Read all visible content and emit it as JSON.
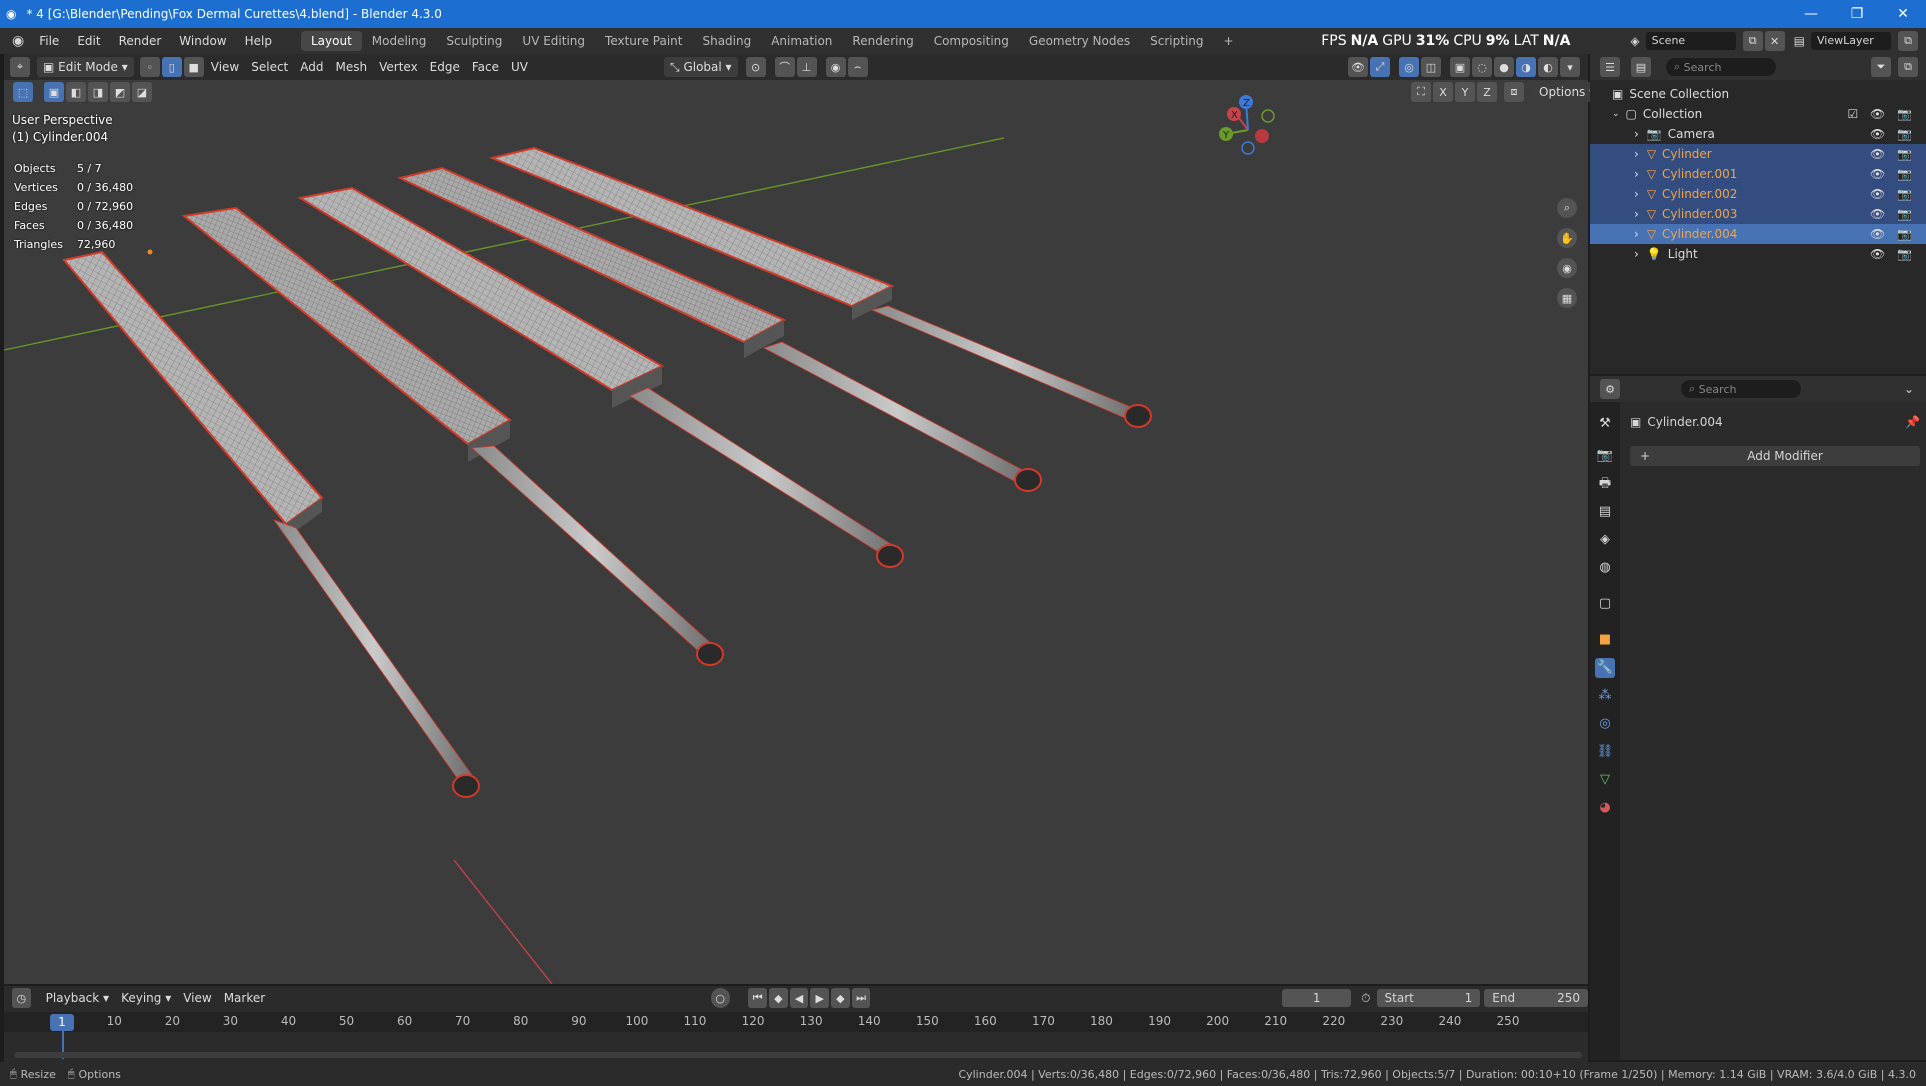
{
  "window": {
    "title": "* 4 [G:\\Blender\\Pending\\Fox Dermal Curettes\\4.blend] - Blender 4.3.0"
  },
  "menus": [
    "File",
    "Edit",
    "Render",
    "Window",
    "Help"
  ],
  "workspaces": [
    "Layout",
    "Modeling",
    "Sculpting",
    "UV Editing",
    "Texture Paint",
    "Shading",
    "Animation",
    "Rendering",
    "Compositing",
    "Geometry Nodes",
    "Scripting"
  ],
  "stats_bar": {
    "fps_label": "FPS",
    "fps": "N/A",
    "gpu_label": "GPU",
    "gpu": "31%",
    "cpu_label": "CPU",
    "cpu": "9%",
    "lat_label": "LAT",
    "lat": "N/A"
  },
  "scene": {
    "name": "Scene",
    "viewlayer": "ViewLayer"
  },
  "viewport_header": {
    "mode": "Edit Mode",
    "menus": [
      "View",
      "Select",
      "Add",
      "Mesh",
      "Vertex",
      "Edge",
      "Face",
      "UV"
    ],
    "orientation": "Global",
    "options": "Options",
    "axes": [
      "X",
      "Y",
      "Z"
    ]
  },
  "viewport": {
    "view_name": "User Perspective",
    "active_object": "(1) Cylinder.004",
    "stats": [
      {
        "label": "Objects",
        "value": "5 / 7"
      },
      {
        "label": "Vertices",
        "value": "0 / 36,480"
      },
      {
        "label": "Edges",
        "value": "0 / 72,960"
      },
      {
        "label": "Faces",
        "value": "0 / 36,480"
      },
      {
        "label": "Triangles",
        "value": "72,960"
      }
    ]
  },
  "outliner": {
    "search_placeholder": "Search",
    "scene_collection": "Scene Collection",
    "collection": "Collection",
    "items": [
      {
        "name": "Camera",
        "state": "normal",
        "icon": "camera-icon"
      },
      {
        "name": "Cylinder",
        "state": "selected",
        "icon": "mesh-icon"
      },
      {
        "name": "Cylinder.001",
        "state": "selected",
        "icon": "mesh-icon"
      },
      {
        "name": "Cylinder.002",
        "state": "selected",
        "icon": "mesh-icon"
      },
      {
        "name": "Cylinder.003",
        "state": "selected",
        "icon": "mesh-icon"
      },
      {
        "name": "Cylinder.004",
        "state": "active",
        "icon": "mesh-icon"
      },
      {
        "name": "Light",
        "state": "normal",
        "icon": "light-icon"
      }
    ]
  },
  "properties": {
    "search_placeholder": "Search",
    "object_name": "Cylinder.004",
    "add_modifier": "Add Modifier"
  },
  "timeline": {
    "menus": [
      "Playback",
      "Keying",
      "View",
      "Marker"
    ],
    "current_frame": "1",
    "start_label": "Start",
    "start": "1",
    "end_label": "End",
    "end": "250",
    "ticks": [
      "10",
      "20",
      "30",
      "40",
      "50",
      "60",
      "70",
      "80",
      "90",
      "100",
      "110",
      "120",
      "130",
      "140",
      "150",
      "160",
      "170",
      "180",
      "190",
      "200",
      "210",
      "220",
      "230",
      "240",
      "250"
    ],
    "frame_indicator": "1"
  },
  "status_bar": {
    "left": [
      "Resize",
      "Options"
    ],
    "right": "Cylinder.004 | Verts:0/36,480 | Edges:0/72,960 | Faces:0/36,480 | Tris:72,960 | Objects:5/7 | Duration: 00:10+10 (Frame 1/250) | Memory: 1.14 GiB | VRAM: 3.6/4.0 GiB | 4.3.0"
  },
  "colors": {
    "accent": "#4772b3",
    "title_bar": "#1c6fd0",
    "selected_outline": "#d23a2a",
    "viewport_bg": "#3c3c3c",
    "x_axis": "#c8424a",
    "y_axis": "#6a9a2a"
  }
}
